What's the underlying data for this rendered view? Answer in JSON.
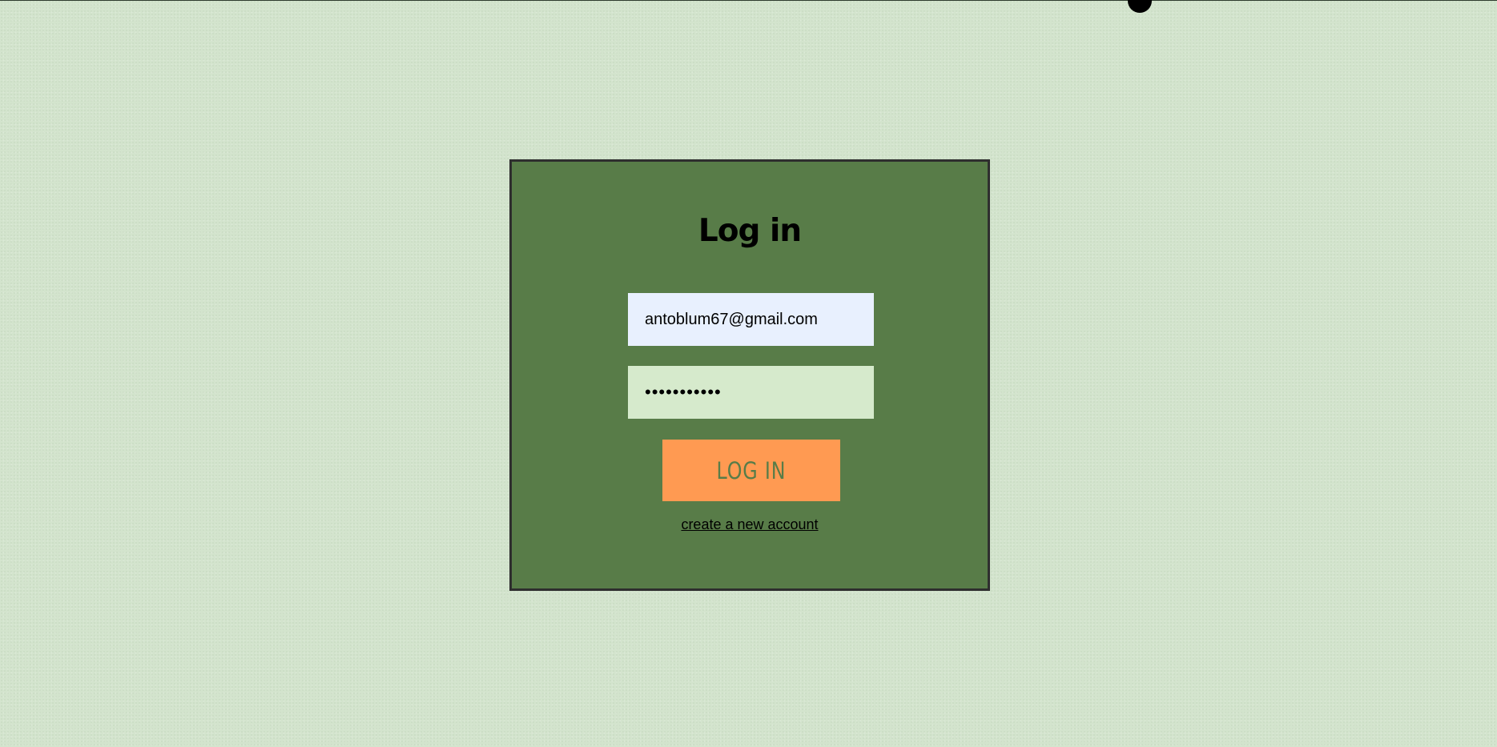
{
  "login": {
    "title": "Log in",
    "email_value": "antoblum67@gmail.com",
    "password_value": "•••••••••••",
    "submit_label": "LOG IN",
    "create_account_link": "create a new account"
  },
  "colors": {
    "background": "#d3e4cd",
    "card": "#587c48",
    "card_border": "#2e2e2e",
    "email_field": "#e8f0fe",
    "password_field": "#d6eacc",
    "button": "#ff9a52",
    "button_text": "#587c48"
  }
}
